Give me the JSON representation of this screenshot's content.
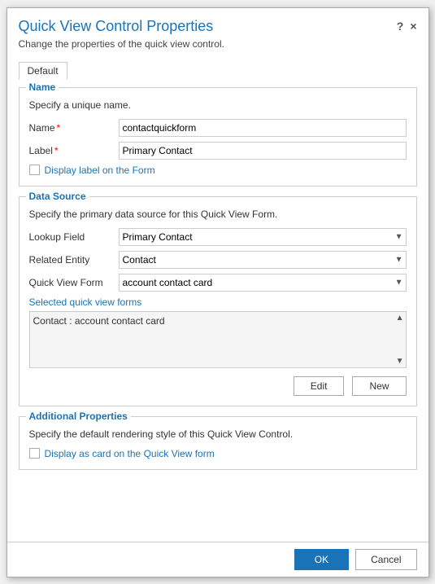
{
  "dialog": {
    "title": "Quick View Control Properties",
    "subtitle": "Change the properties of the quick view control.",
    "help_icon": "?",
    "close_icon": "×"
  },
  "tabs": [
    {
      "label": "Default",
      "active": true
    }
  ],
  "name_section": {
    "legend": "Name",
    "description": "Specify a unique name.",
    "name_label": "Name",
    "name_required": true,
    "name_value": "contactquickform",
    "label_label": "Label",
    "label_required": true,
    "label_value": "Primary Contact",
    "checkbox_label": "Display label on the Form"
  },
  "datasource_section": {
    "legend": "Data Source",
    "description": "Specify the primary data source for this Quick View Form.",
    "lookup_field_label": "Lookup Field",
    "lookup_field_value": "Primary Contact",
    "lookup_field_options": [
      "Primary Contact"
    ],
    "related_entity_label": "Related Entity",
    "related_entity_value": "Contact",
    "related_entity_options": [
      "Contact"
    ],
    "quick_view_form_label": "Quick View Form",
    "quick_view_form_value": "account contact card",
    "quick_view_form_options": [
      "account contact card"
    ],
    "selected_forms_label": "Selected quick view forms",
    "selected_forms_item": "Contact : account contact card",
    "edit_button": "Edit",
    "new_button": "New"
  },
  "additional_section": {
    "legend": "Additional Properties",
    "description": "Specify the default rendering style of this Quick View Control.",
    "checkbox_label": "Display as card on the Quick View form"
  },
  "footer": {
    "ok_button": "OK",
    "cancel_button": "Cancel"
  }
}
